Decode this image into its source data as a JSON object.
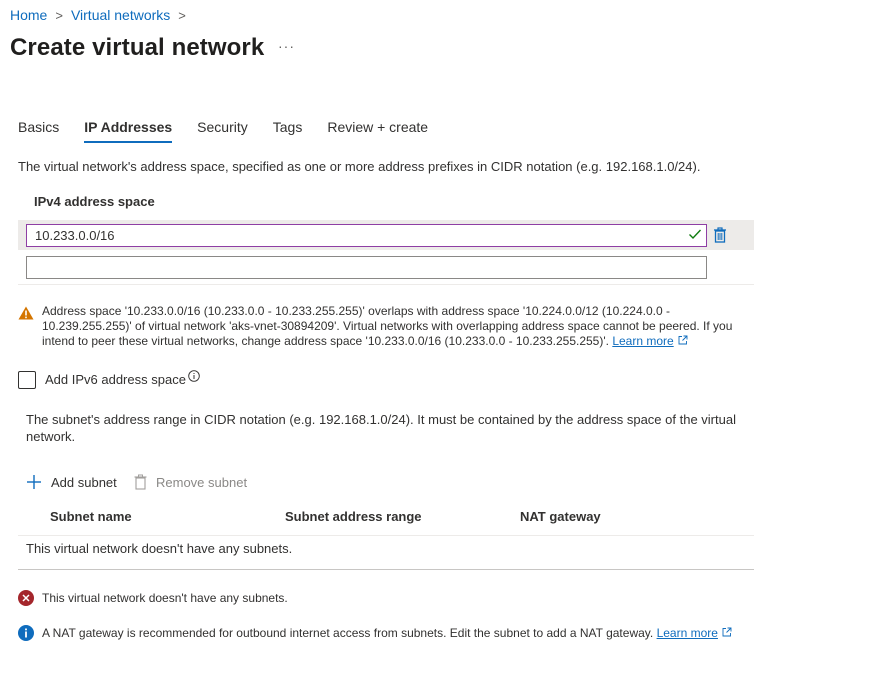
{
  "breadcrumb": {
    "items": [
      "Home",
      "Virtual networks"
    ],
    "separator": ">"
  },
  "page": {
    "title": "Create virtual network",
    "more_label": "···"
  },
  "tabs": [
    {
      "label": "Basics",
      "active": false
    },
    {
      "label": "IP Addresses",
      "active": true
    },
    {
      "label": "Security",
      "active": false
    },
    {
      "label": "Tags",
      "active": false
    },
    {
      "label": "Review + create",
      "active": false
    }
  ],
  "description": "The virtual network's address space, specified as one or more address prefixes in CIDR notation (e.g. 192.168.1.0/24).",
  "ipv4": {
    "label": "IPv4 address space",
    "value": "10.233.0.0/16",
    "empty_value": "",
    "valid_icon": "checkmark-icon",
    "delete_icon": "trash-icon"
  },
  "warning": {
    "icon": "warning-icon",
    "text": "Address space '10.233.0.0/16 (10.233.0.0 - 10.233.255.255)' overlaps with address space '10.224.0.0/12 (10.224.0.0 - 10.239.255.255)' of virtual network 'aks-vnet-30894209'. Virtual networks with overlapping address space cannot be peered. If you intend to peer these virtual networks, change address space '10.233.0.0/16 (10.233.0.0 - 10.233.255.255)'.",
    "link": "Learn more"
  },
  "ipv6": {
    "label": "Add IPv6 address space",
    "checked": false,
    "info_icon": "info-icon"
  },
  "subnet": {
    "description": "The subnet's address range in CIDR notation (e.g. 192.168.1.0/24). It must be contained by the address space of the virtual network.",
    "add_label": "Add subnet",
    "remove_label": "Remove subnet",
    "columns": [
      "Subnet name",
      "Subnet address range",
      "NAT gateway"
    ],
    "empty_text": "This virtual network doesn't have any subnets."
  },
  "messages": {
    "error": {
      "icon": "error-icon",
      "text": "This virtual network doesn't have any subnets."
    },
    "info": {
      "icon": "info-icon",
      "text": "A NAT gateway is recommended for outbound internet access from subnets. Edit the subnet to add a NAT gateway.",
      "link": "Learn more"
    }
  },
  "colors": {
    "accent": "#0f6cbd",
    "warning": "#d47500",
    "error": "#a4262c",
    "info": "#0f6cbd",
    "valid": "#107c10",
    "focus_border": "#8e3ea4"
  }
}
